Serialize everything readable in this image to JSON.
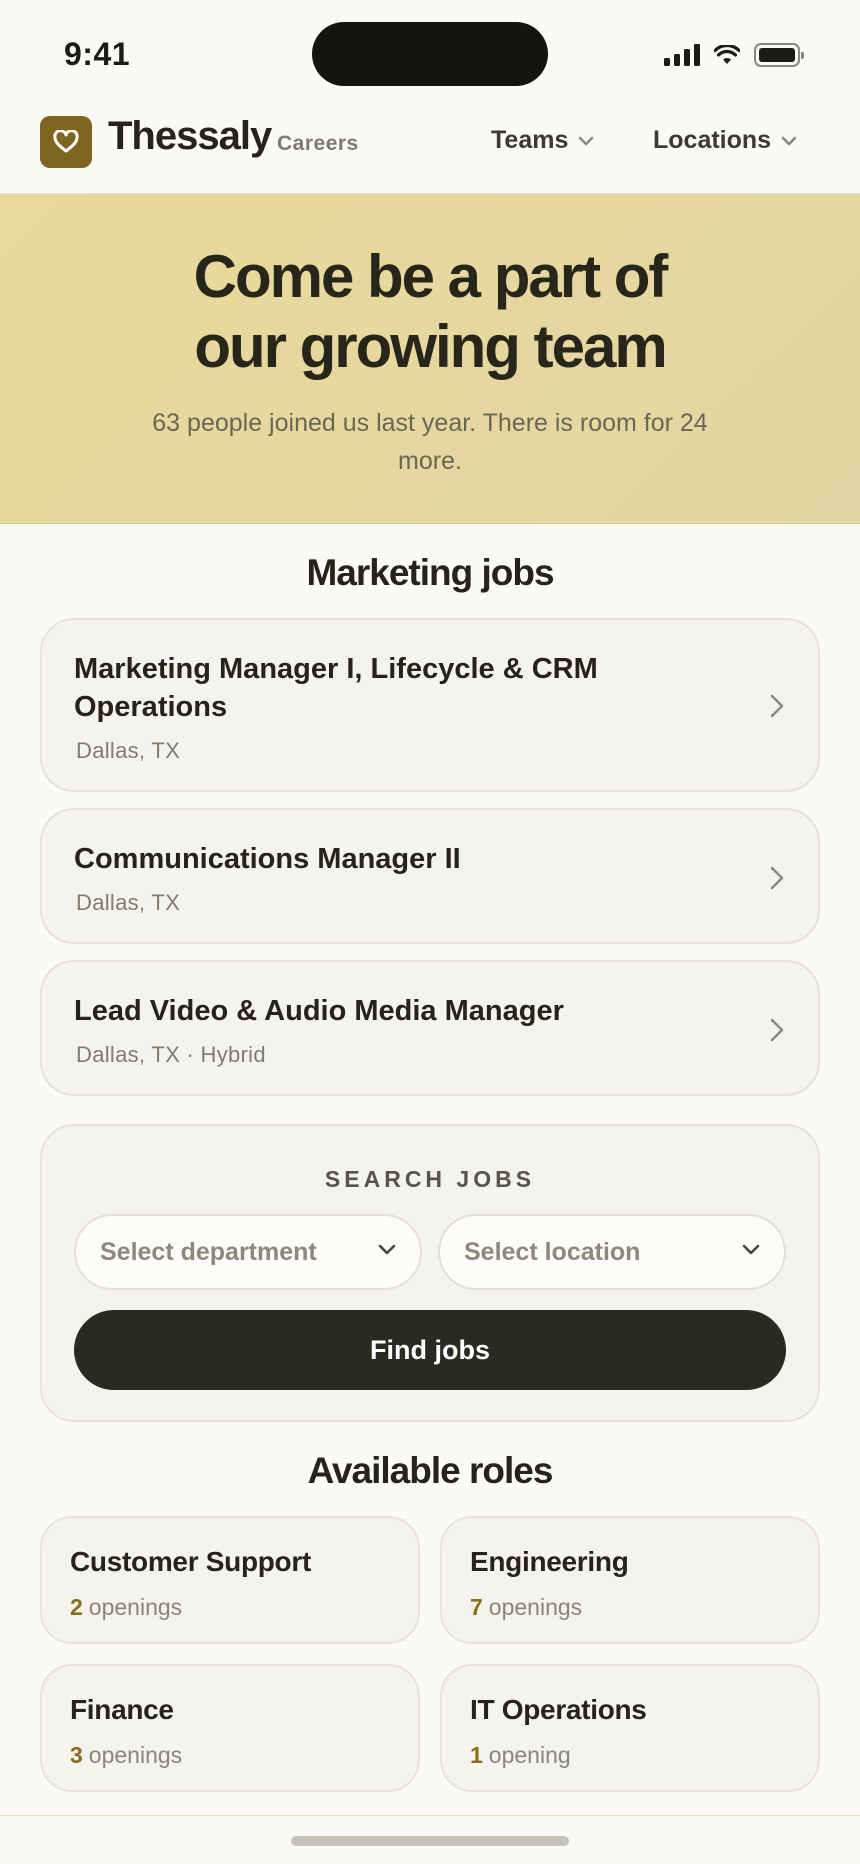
{
  "status_bar": {
    "time": "9:41"
  },
  "header": {
    "brand": "Thessaly",
    "subtitle": "Careers",
    "nav": [
      {
        "label": "Teams"
      },
      {
        "label": "Locations"
      }
    ]
  },
  "hero": {
    "title_line1": "Come be a part of",
    "title_line2": "our growing team",
    "subtitle": "63 people joined us last year. There is room for 24 more."
  },
  "marketing": {
    "title": "Marketing jobs",
    "jobs": [
      {
        "title": "Marketing Manager I, Lifecycle & CRM Operations",
        "location": "Dallas, TX"
      },
      {
        "title": "Communications Manager II",
        "location": "Dallas, TX"
      },
      {
        "title": "Lead Video & Audio Media Manager",
        "location": "Dallas, TX · Hybrid"
      }
    ]
  },
  "search": {
    "label": "SEARCH JOBS",
    "department_placeholder": "Select department",
    "location_placeholder": "Select location",
    "button": "Find jobs"
  },
  "roles": {
    "title": "Available roles",
    "items": [
      {
        "name": "Customer Support",
        "count": "2",
        "unit": "openings"
      },
      {
        "name": "Engineering",
        "count": "7",
        "unit": "openings"
      },
      {
        "name": "Finance",
        "count": "3",
        "unit": "openings"
      },
      {
        "name": "IT Operations",
        "count": "1",
        "unit": "opening"
      }
    ]
  },
  "colors": {
    "accent": "#7f6520",
    "hero_bg": "#e8d89c",
    "button_dark": "#2b2a1e"
  }
}
